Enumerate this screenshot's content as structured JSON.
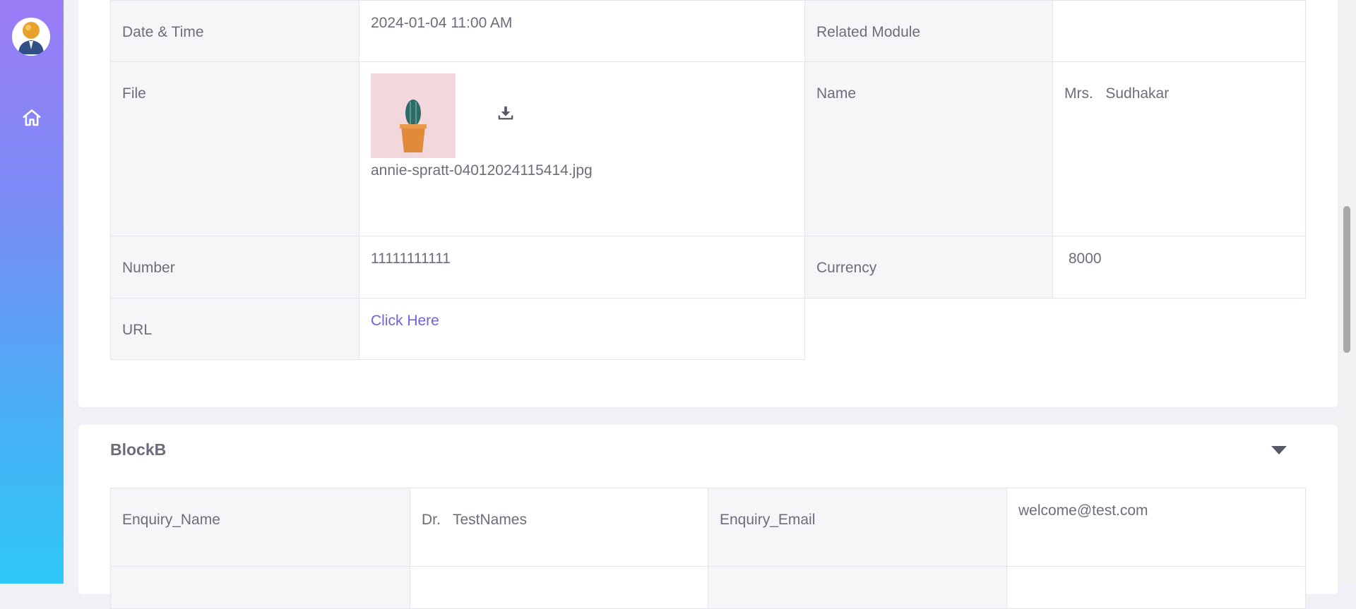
{
  "sidebar": {
    "items": [
      {
        "icon": "home-icon"
      }
    ]
  },
  "block_a": {
    "rows": [
      {
        "label1": "Date & Time",
        "value1": "2024-01-04 11:00 AM",
        "label2": "Related Module",
        "value2": ""
      },
      {
        "label1": "File",
        "file_name": "annie-spratt-04012024115414.jpg",
        "label2": "Name",
        "value2": "Mrs.   Sudhakar"
      },
      {
        "label1": "Number",
        "value1": "11111111111",
        "label2": "Currency",
        "value2": " 8000"
      },
      {
        "label1": "URL",
        "link_text": "Click Here"
      }
    ]
  },
  "block_b": {
    "title": "BlockB",
    "rows": [
      {
        "label1": "Enquiry_Name",
        "value1": "Dr.   TestNames",
        "label2": "Enquiry_Email",
        "value2": "welcome@test.com"
      }
    ]
  },
  "colors": {
    "accent": "#6c63d8",
    "label_bg": "#f6f6f9",
    "sidebar_top": "#9b7bf6",
    "sidebar_bottom": "#2ec8f7"
  }
}
